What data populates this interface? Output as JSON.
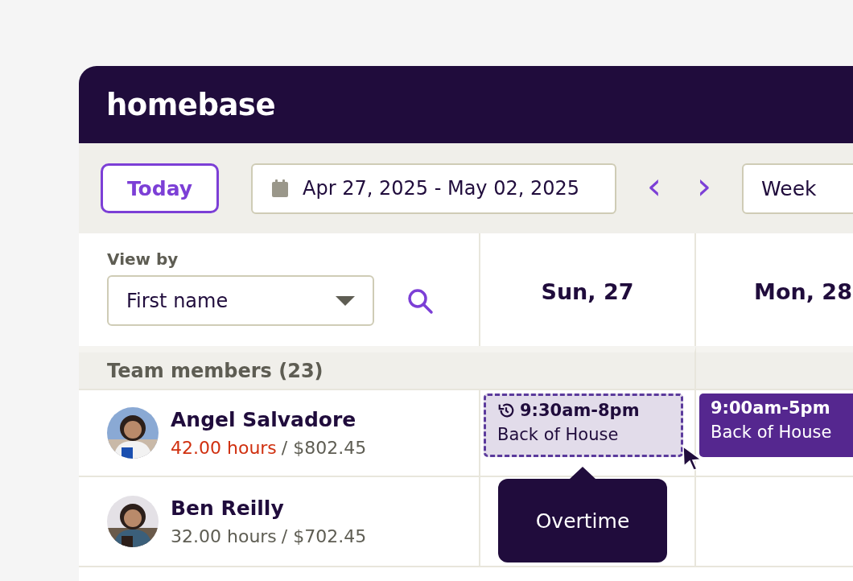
{
  "app": {
    "logo": "homebase"
  },
  "toolbar": {
    "today_button": "Today",
    "date_range": "Apr 27, 2025 - May 02, 2025",
    "prev": "‹",
    "next": "›",
    "view_select": "Week"
  },
  "view_by": {
    "label": "View by",
    "value": "First name"
  },
  "days": [
    {
      "label": "Sun, 27"
    },
    {
      "label": "Mon, 28"
    }
  ],
  "team_header": "Team members (23)",
  "members": [
    {
      "name": "Angel Salvadore",
      "hours": "42.00 hours",
      "overtime": true,
      "cost": "/ $802.45",
      "shifts": [
        {
          "kind": "overtime",
          "time": "9:30am-8pm",
          "role": "Back of House"
        },
        {
          "kind": "scheduled",
          "time": "9:00am-5pm",
          "role": "Back of House"
        }
      ]
    },
    {
      "name": "Ben Reilly",
      "hours": "32.00 hours",
      "overtime": false,
      "cost": "/ $702.45"
    }
  ],
  "tooltip": "Overtime"
}
